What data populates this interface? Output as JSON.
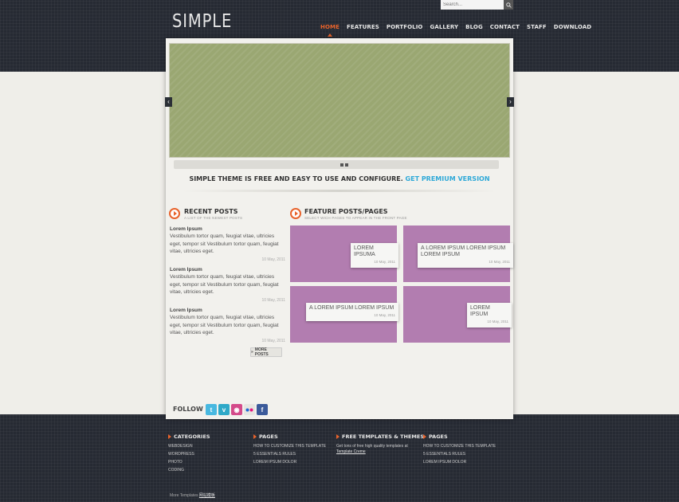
{
  "header": {
    "logo": "SIMPLE",
    "search_placeholder": "Search...",
    "nav": [
      "HOME",
      "FEATURES",
      "PORTFOLIO",
      "GALLERY",
      "BLOG",
      "CONTACT",
      "STAFF",
      "DOWNLOAD"
    ],
    "active_nav": "HOME"
  },
  "slider": {
    "color": "#9aa772"
  },
  "tagline": {
    "text": "SIMPLE THEME IS FREE AND EASY TO USE AND CONFIGURE.",
    "link": "GET PREMIUM VERSION"
  },
  "recent_posts": {
    "title": "RECENT POSTS",
    "subtitle": "A LIST OF THE NEWEST POSTS",
    "posts": [
      {
        "title": "Lorem Ipsum",
        "body": "Vestibulum tortor quam, feugiat vitae, ultricies eget, tempor sit Vestibulum tortor quam, feugiat vitae, ultricies eget.",
        "date": "10 May, 2011"
      },
      {
        "title": "Lorem Ipsum",
        "body": "Vestibulum tortor quam, feugiat vitae, ultricies eget, tempor sit Vestibulum tortor quam, feugiat vitae, ultricies eget.",
        "date": "10 May, 2011"
      },
      {
        "title": "Lorem Ipsum",
        "body": "Vestibulum tortor quam, feugiat vitae, ultricies eget, tempor sit Vestibulum tortor quam, feugiat vitae, ultricies eget.",
        "date": "10 May, 2011"
      }
    ],
    "more_label": "MORE POSTS"
  },
  "feature_posts": {
    "title": "FEATURE POSTS/PAGES",
    "subtitle": "SELECT WICH PAGES TO APPEAR IN THE FRONT PAGE",
    "items": [
      {
        "label": "LOREM IPSUMA",
        "date": "10 May, 2011"
      },
      {
        "label": "A LOREM IPSUM LOREM IPSUM LOREM IPSUM",
        "date": "10 May, 2011"
      },
      {
        "label": "A LOREM IPSUM LOREM IPSUM",
        "date": "10 May, 2011"
      },
      {
        "label": "LOREM IPSUM",
        "date": "10 May, 2011"
      }
    ]
  },
  "follow": {
    "label": "FOLLOW US",
    "icons": [
      "twitter-icon",
      "vimeo-icon",
      "dribbble-icon",
      "flickr-icon",
      "facebook-icon"
    ]
  },
  "footer": {
    "columns": [
      {
        "heading": "CATEGORIES",
        "items": [
          "WEBDESIGN",
          "WORDPRESS",
          "PHOTO",
          "CODING"
        ]
      },
      {
        "heading": "PAGES",
        "items": [
          "HOW TO CUSTOMIZE THIS TEMPLATE",
          "5 ESSENTIALS RULES",
          "LOREM IPSUM DOLOR"
        ]
      },
      {
        "heading": "FREE TEMPLATES & THEMES",
        "items": [
          "Get tons of free high quality templates at"
        ],
        "link": "Template Creme"
      },
      {
        "heading": "PAGES",
        "items": [
          "HOW TO CUSTOMIZE THIS TEMPLATE",
          "5 ESSENTIALS RULES",
          "LOREM IPSUM DOLOR"
        ]
      }
    ],
    "credit_text": "More Templates",
    "credit_link": "网站模板"
  },
  "colors": {
    "accent": "#e8632c",
    "link": "#2fa9d8",
    "feature_tile": "#b27db0",
    "dark_band": "#262a33"
  }
}
